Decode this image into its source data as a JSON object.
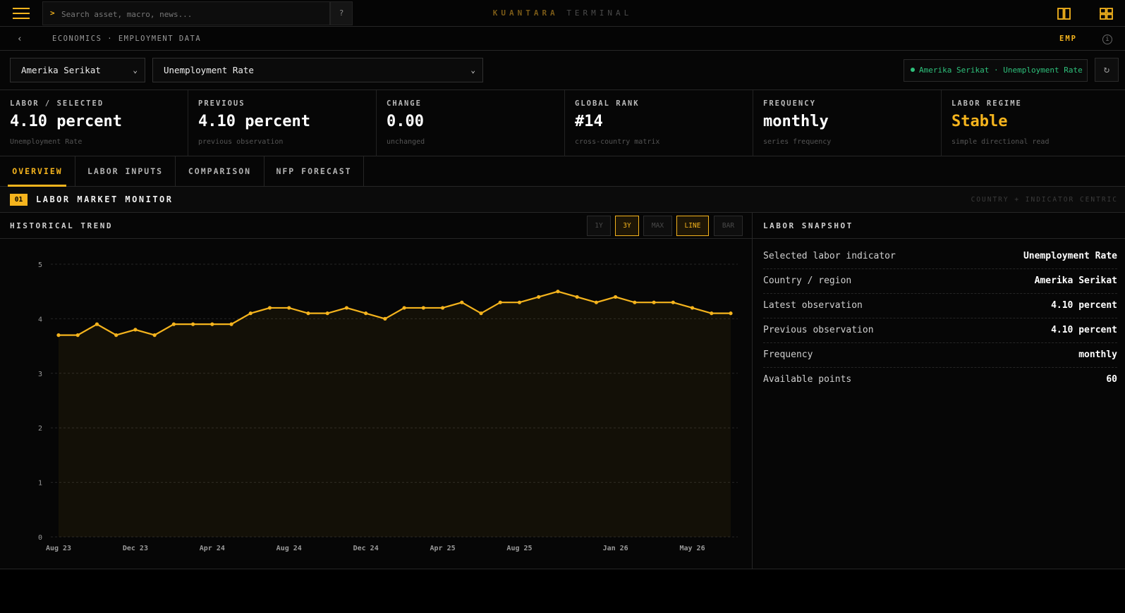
{
  "topbar": {
    "search_prompt": ">",
    "search_placeholder": "Search asset, macro, news...",
    "help_label": "?",
    "brand_primary": "KUANTARA",
    "brand_secondary": "TERMINAL"
  },
  "breadcrumb": {
    "back": "‹",
    "path": "ECONOMICS · EMPLOYMENT DATA",
    "code": "EMP",
    "info": "i"
  },
  "controls": {
    "country": "Amerika Serikat",
    "indicator": "Unemployment Rate",
    "chevron": "⌄",
    "status": "Amerika Serikat · Unemployment Rate",
    "refresh": "↻"
  },
  "stats": [
    {
      "label": "LABOR / SELECTED",
      "value": "4.10 percent",
      "sub": "Unemployment Rate"
    },
    {
      "label": "PREVIOUS",
      "value": "4.10 percent",
      "sub": "previous observation"
    },
    {
      "label": "CHANGE",
      "value": "0.00",
      "sub": "unchanged"
    },
    {
      "label": "GLOBAL RANK",
      "value": "#14",
      "sub": "cross-country matrix"
    },
    {
      "label": "FREQUENCY",
      "value": "monthly",
      "sub": "series frequency"
    },
    {
      "label": "LABOR REGIME",
      "value": "Stable",
      "sub": "simple directional read"
    }
  ],
  "tabs": [
    "OVERVIEW",
    "LABOR INPUTS",
    "COMPARISON",
    "NFP FORECAST"
  ],
  "section": {
    "number": "01",
    "title": "LABOR MARKET MONITOR",
    "right": "COUNTRY + INDICATOR CENTRIC"
  },
  "trend_panel": {
    "title": "HISTORICAL TREND",
    "range_buttons": [
      "1Y",
      "3Y",
      "MAX"
    ],
    "type_buttons": [
      "LINE",
      "BAR"
    ],
    "active_range": "3Y",
    "active_type": "LINE"
  },
  "snapshot": {
    "title": "LABOR SNAPSHOT",
    "rows": [
      {
        "key": "Selected labor indicator",
        "value": "Unemployment Rate"
      },
      {
        "key": "Country / region",
        "value": "Amerika Serikat"
      },
      {
        "key": "Latest observation",
        "value": "4.10 percent"
      },
      {
        "key": "Previous observation",
        "value": "4.10 percent"
      },
      {
        "key": "Frequency",
        "value": "monthly"
      },
      {
        "key": "Available points",
        "value": "60"
      }
    ]
  },
  "colors": {
    "accent": "#f5b41d",
    "status": "#2ec07b",
    "background": "#060606"
  },
  "chart_data": {
    "type": "line",
    "x": [
      "Aug 23",
      "Sep 23",
      "Oct 23",
      "Nov 23",
      "Dec 23",
      "Jan 24",
      "Feb 24",
      "Mar 24",
      "Apr 24",
      "May 24",
      "Jun 24",
      "Jul 24",
      "Aug 24",
      "Sep 24",
      "Oct 24",
      "Nov 24",
      "Dec 24",
      "Jan 25",
      "Feb 25",
      "Mar 25",
      "Apr 25",
      "May 25",
      "Jun 25",
      "Jul 25",
      "Aug 25",
      "Sep 25",
      "Oct 25",
      "Nov 25",
      "Dec 25",
      "Jan 26",
      "Feb 26",
      "Mar 26",
      "Apr 26",
      "May 26",
      "Jun 26",
      "Jul 26"
    ],
    "values": [
      3.7,
      3.7,
      3.9,
      3.7,
      3.8,
      3.7,
      3.9,
      3.9,
      3.9,
      3.9,
      4.1,
      4.2,
      4.2,
      4.1,
      4.1,
      4.2,
      4.1,
      4.0,
      4.2,
      4.2,
      4.2,
      4.3,
      4.1,
      4.3,
      4.3,
      4.4,
      4.5,
      4.4,
      4.3,
      4.4,
      4.3,
      4.3,
      4.3,
      4.2,
      4.1,
      4.1
    ],
    "x_tick_labels": [
      "Aug 23",
      "Dec 23",
      "Apr 24",
      "Aug 24",
      "Dec 24",
      "Apr 25",
      "Aug 25",
      "Jan 26",
      "May 26"
    ],
    "x_tick_index": [
      0,
      4,
      8,
      12,
      16,
      20,
      24,
      29,
      33
    ],
    "y_ticks": [
      0,
      1,
      2,
      3,
      4,
      5
    ],
    "ylim": [
      0,
      5
    ],
    "grid": true,
    "title": "",
    "xlabel": "",
    "ylabel": ""
  }
}
